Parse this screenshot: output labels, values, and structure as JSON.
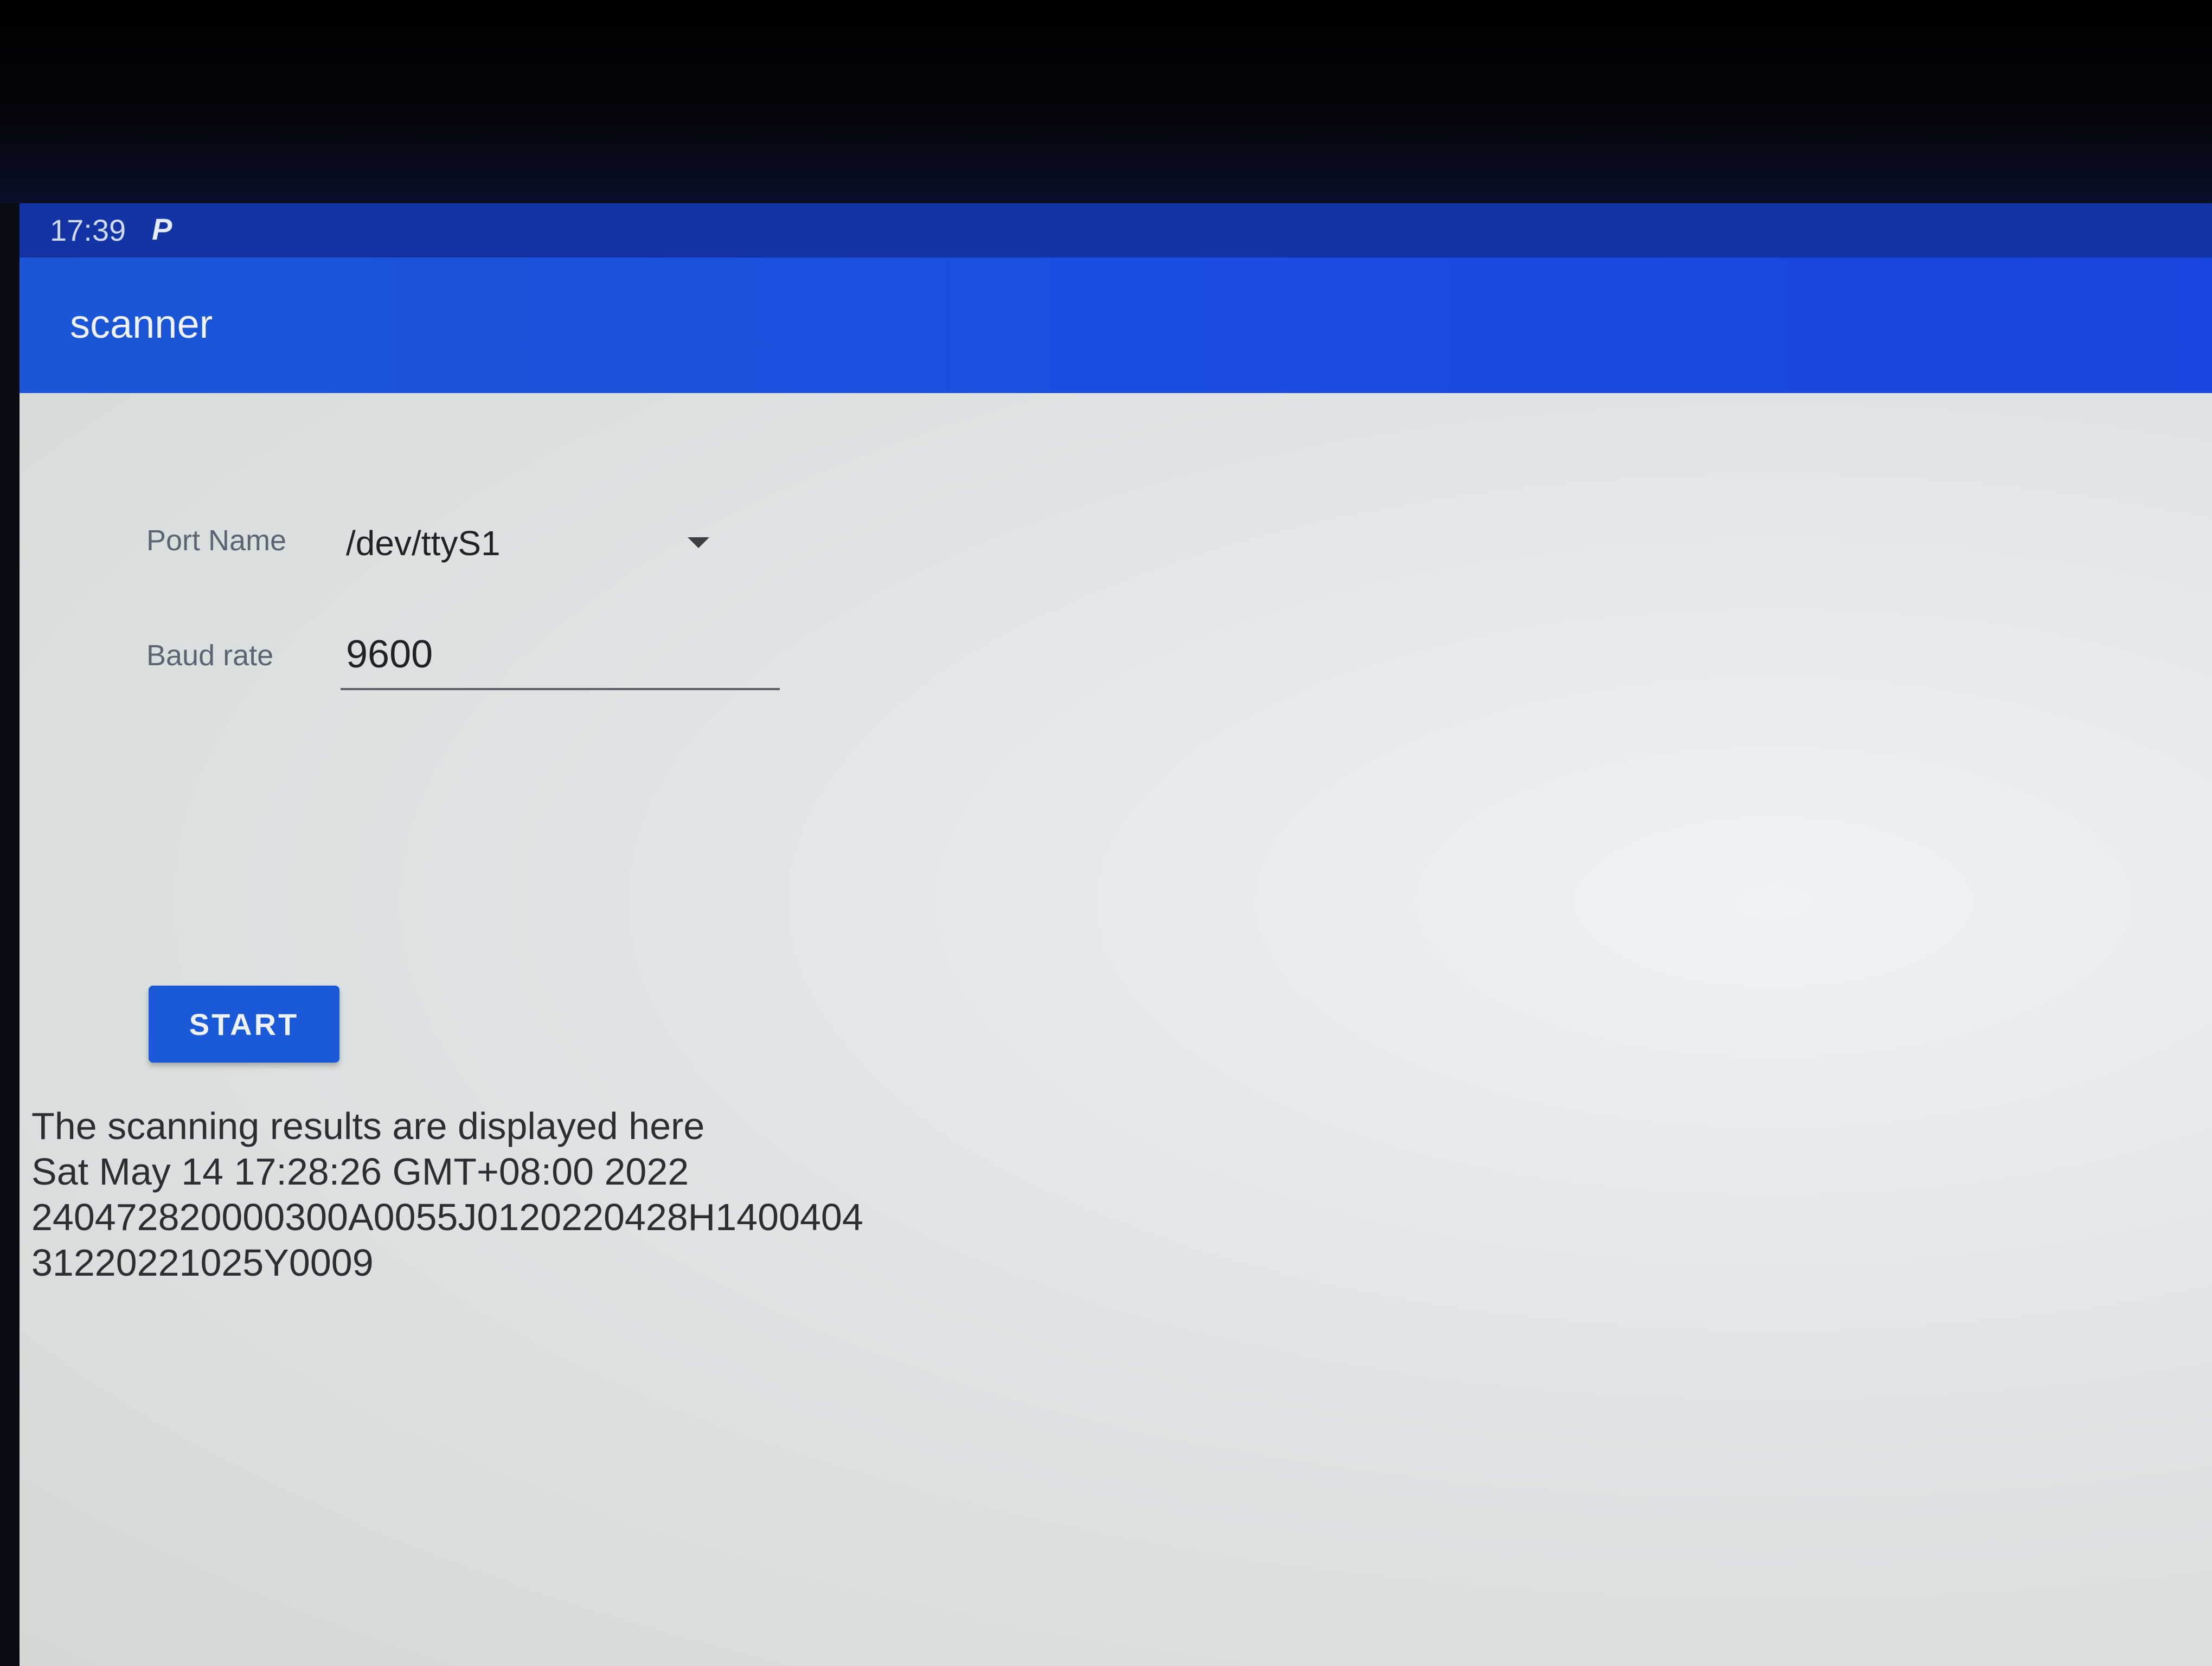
{
  "status_bar": {
    "time": "17:39",
    "notification_icon": "P"
  },
  "app_bar": {
    "title": "scanner"
  },
  "form": {
    "port_label": "Port Name",
    "port_value": "/dev/ttyS1",
    "baud_label": "Baud rate",
    "baud_value": "9600"
  },
  "start_button": {
    "label": "START"
  },
  "results": {
    "lines": [
      "The scanning results are displayed here",
      "Sat May 14 17:28:26 GMT+08:00 2022",
      "240472820000300A0055J0120220428H1400404",
      "31220221025Y0009"
    ]
  },
  "colors": {
    "status_bar": "#1334a4",
    "app_bar": "#1a4ee0",
    "accent_button": "#1a59d8",
    "content_background": "#dfe4e6"
  }
}
